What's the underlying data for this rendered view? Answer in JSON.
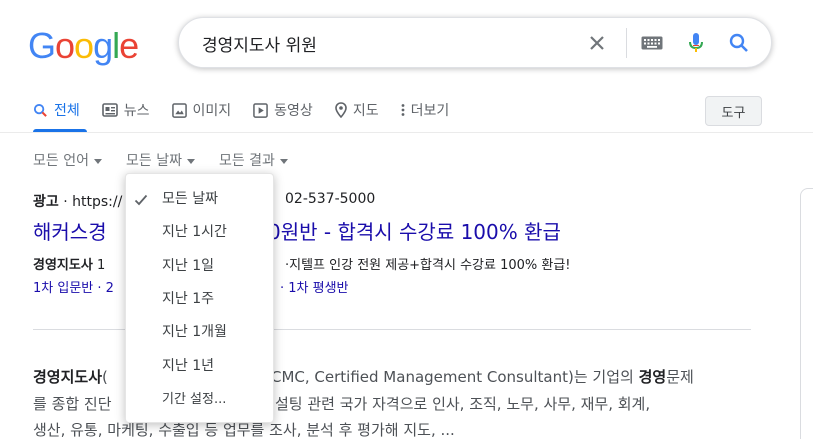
{
  "logo": {
    "letters": [
      "G",
      "o",
      "o",
      "g",
      "l",
      "e"
    ],
    "colors": [
      "#4285F4",
      "#EA4335",
      "#FBBC05",
      "#4285F4",
      "#34A853",
      "#EA4335"
    ]
  },
  "search": {
    "query": "경영지도사 위원",
    "icons": [
      "clear-icon",
      "keyboard-icon",
      "mic-icon",
      "search-icon"
    ]
  },
  "tabs": [
    {
      "label": "전체",
      "icon": "search-icon",
      "active": true
    },
    {
      "label": "뉴스",
      "icon": "news-icon"
    },
    {
      "label": "이미지",
      "icon": "image-icon"
    },
    {
      "label": "동영상",
      "icon": "video-icon"
    },
    {
      "label": "지도",
      "icon": "map-pin-icon"
    },
    {
      "label": "더보기",
      "icon": "more-icon"
    }
  ],
  "tools_label": "도구",
  "filters": [
    "모든 언어",
    "모든 날짜",
    "모든 결과"
  ],
  "ad": {
    "label": "광고",
    "url": "https://",
    "phone": "02-537-5000",
    "title_left": "해커스경",
    "title_right": "0원반 - 합격시 수강료 100% 환급",
    "desc_bold": "경영지도사",
    "desc_left": " 1",
    "desc_right": "·지텔프 인강 전원 제공+합격시 수강료 100% 환급!",
    "links_left": "1차 입문반 · 2",
    "links_right": "· 1차 평생반"
  },
  "snippet": {
    "line1_bold": "경영지도사",
    "line1_left": "(",
    "line1_right": "CMC, Certified Management Consultant)는 기업의 ",
    "line1_bold2": "경영",
    "line1_end": "문제",
    "line2_left": "를 종합 진단",
    "line2_right": "설팅 관련 국가 자격으로 인사, 조직, 노무, 사무, 재무, 회계,",
    "line3": "생산, 유통, 마케팅, 수출입 등 업무를 조사, 분석 후 평가해 지도, ..."
  },
  "dropdown": {
    "items": [
      "모든 날짜",
      "지난 1시간",
      "지난 1일",
      "지난 1주",
      "지난 1개월",
      "지난 1년",
      "기간 설정..."
    ],
    "selected": "모든 날짜"
  }
}
